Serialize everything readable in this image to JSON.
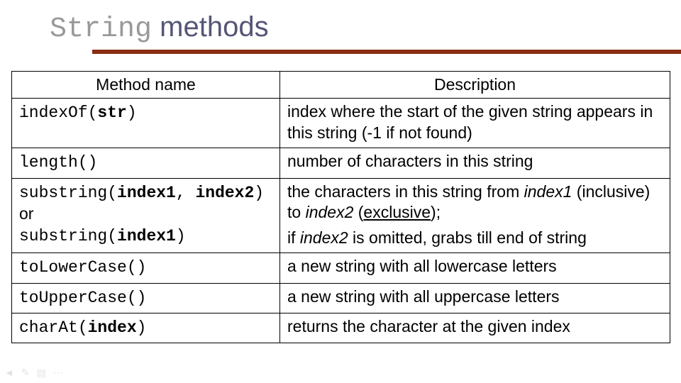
{
  "title": {
    "part1": "String",
    "part2": " methods"
  },
  "table": {
    "headers": {
      "c1": "Method name",
      "c2": "Description"
    },
    "rows": [
      {
        "method": {
          "pre": "indexOf(",
          "arg": "str",
          "post": ")"
        },
        "desc": "index where the start of the given string appears in this string (-1 if not found)"
      },
      {
        "method": {
          "pre": "length()",
          "arg": "",
          "post": ""
        },
        "desc": "number of characters in this string"
      },
      {
        "method": {
          "line1_pre": "substring(",
          "line1_arg1": "index1",
          "line1_mid": ", ",
          "line1_arg2": "index2",
          "line1_post": ")",
          "or": "or",
          "line2_pre": "substring(",
          "line2_arg": "index1",
          "line2_post": ")"
        },
        "desc": {
          "p1a": "the characters in this string from ",
          "p1_idx1": "index1",
          "p1b": " (inclusive) to ",
          "p1_idx2": "index2",
          "p1c": " (",
          "p1_excl": "exclusive",
          "p1d": ");",
          "p2a": "if ",
          "p2_idx2": "index2",
          "p2b": " is omitted, grabs till end of string"
        }
      },
      {
        "method": {
          "pre": "toLowerCase()",
          "arg": "",
          "post": ""
        },
        "desc": "a new string with all lowercase letters"
      },
      {
        "method": {
          "pre": "toUpperCase()",
          "arg": "",
          "post": ""
        },
        "desc": "a new string with all uppercase letters"
      },
      {
        "method": {
          "pre": "charAt(",
          "arg": "index",
          "post": ")"
        },
        "desc": "returns the character at the given index"
      }
    ]
  }
}
